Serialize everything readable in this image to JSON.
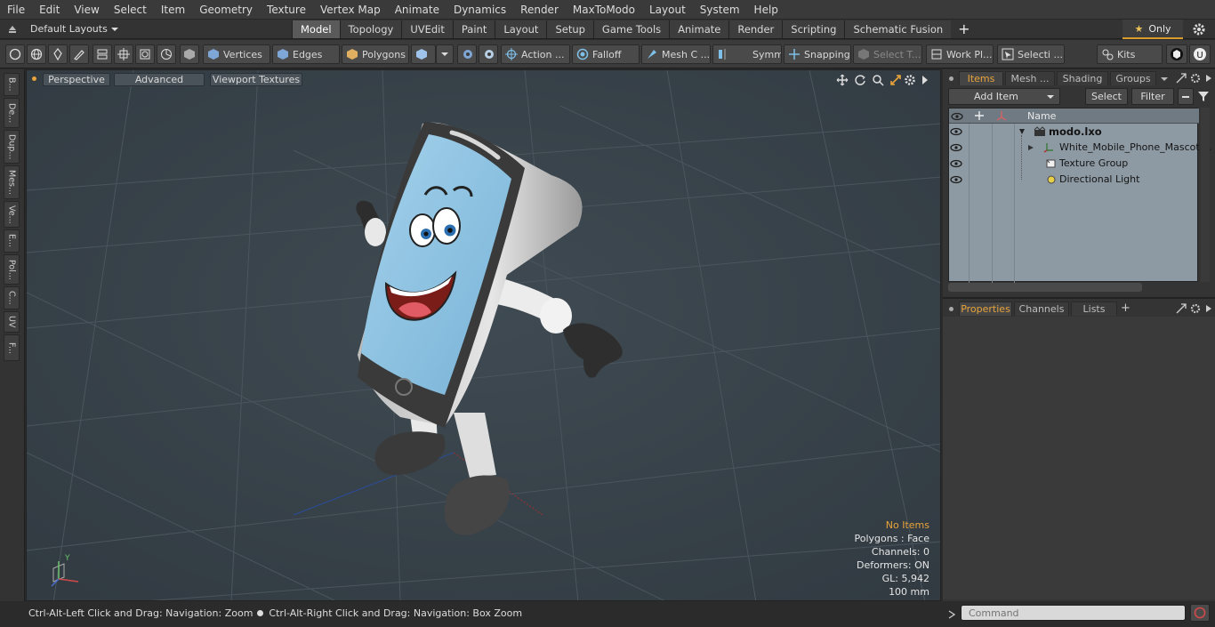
{
  "menubar": [
    "File",
    "Edit",
    "View",
    "Select",
    "Item",
    "Geometry",
    "Texture",
    "Vertex Map",
    "Animate",
    "Dynamics",
    "Render",
    "MaxToModo",
    "Layout",
    "System",
    "Help"
  ],
  "layouts": {
    "label": "Default Layouts"
  },
  "tabs": [
    "Model",
    "Topology",
    "UVEdit",
    "Paint",
    "Layout",
    "Setup",
    "Game Tools",
    "Animate",
    "Render",
    "Scripting",
    "Schematic Fusion"
  ],
  "active_tab": "Model",
  "only_label": "Only",
  "toolbar": {
    "vertices": "Vertices",
    "edges": "Edges",
    "polygons": "Polygons",
    "action": "Action ...",
    "falloff": "Falloff",
    "meshc": "Mesh C ...",
    "symm": "Symm ...",
    "snapping": "Snapping",
    "selectt": "Select T...",
    "workpl": "Work Pl...",
    "selecti": "Selecti ...",
    "kits": "Kits"
  },
  "leftstrip": [
    "B...",
    "De...",
    "Dup...",
    "Mes...",
    "Ve...",
    "E...",
    "Pol...",
    "C...",
    "UV",
    "F..."
  ],
  "viewport": {
    "perspective": "Perspective",
    "advanced": "Advanced",
    "textures": "Viewport Textures",
    "stats": {
      "no_items": "No Items",
      "polygons": "Polygons : Face",
      "channels": "Channels: 0",
      "deformers": "Deformers: ON",
      "gl": "GL: 5,942",
      "scale": "100 mm"
    },
    "axis_y": "Y"
  },
  "items_panel": {
    "tabs": [
      "Items",
      "Mesh ...",
      "Shading",
      "Groups"
    ],
    "add_item": "Add Item",
    "select": "Select",
    "filter": "Filter",
    "name_header": "Name",
    "rows": [
      "modo.lxo",
      "White_Mobile_Phone_Mascot ...",
      "Texture Group",
      "Directional Light"
    ]
  },
  "props_panel": {
    "tabs": [
      "Properties",
      "Channels",
      "Lists"
    ]
  },
  "status": {
    "hint1": "Ctrl-Alt-Left Click and Drag: Navigation: Zoom",
    "hint2": "Ctrl-Alt-Right Click and Drag: Navigation: Box Zoom"
  },
  "command": {
    "placeholder": "Command"
  },
  "colors": {
    "accent": "#e9a43a",
    "viewport_bg": "#39434a",
    "screen_blue": "#8cc3e2"
  }
}
